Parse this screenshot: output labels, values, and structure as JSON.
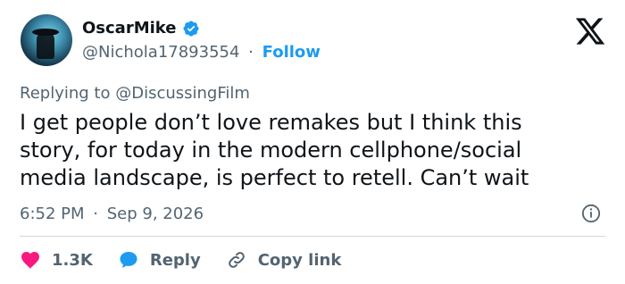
{
  "user": {
    "name": "OscarMike",
    "handle": "@Nichola17893554",
    "separator": "·",
    "follow_label": "Follow"
  },
  "replying": {
    "prefix": "Replying to",
    "mention": "@DiscussingFilm"
  },
  "tweet": {
    "text": "I get people don’t love remakes but I think this\nstory, for today in the modern cellphone/social\nmedia landscape, is perfect to retell. Can’t wait"
  },
  "meta": {
    "time": "6:52 PM",
    "separator": "·",
    "date": "Sep 9, 2026"
  },
  "actions": {
    "likes": "1.3K",
    "reply_label": "Reply",
    "copy_label": "Copy link"
  },
  "icons": {
    "verified": "verified-badge-icon",
    "x_logo": "x-logo-icon",
    "info": "info-icon",
    "heart": "heart-icon",
    "reply": "reply-bubble-icon",
    "link": "link-icon"
  },
  "colors": {
    "accent": "#1d9bf0",
    "heart": "#f91880",
    "secondary_text": "#536471",
    "divider": "#cfd9de"
  }
}
